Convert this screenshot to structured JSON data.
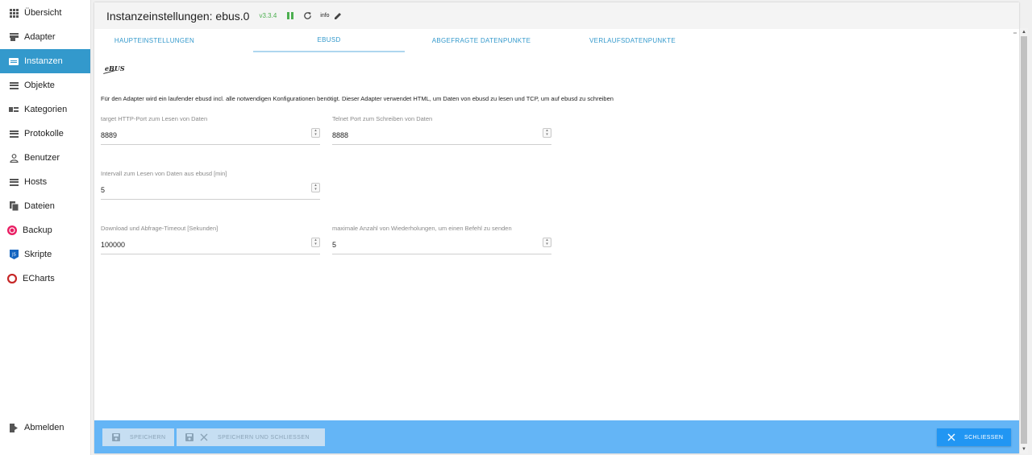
{
  "sidebar": {
    "items": [
      {
        "label": "Übersicht"
      },
      {
        "label": "Adapter"
      },
      {
        "label": "Instanzen"
      },
      {
        "label": "Objekte"
      },
      {
        "label": "Kategorien"
      },
      {
        "label": "Protokolle"
      },
      {
        "label": "Benutzer"
      },
      {
        "label": "Hosts"
      },
      {
        "label": "Dateien"
      },
      {
        "label": "Backup"
      },
      {
        "label": "Skripte"
      },
      {
        "label": "ECharts"
      }
    ],
    "logout": "Abmelden"
  },
  "header": {
    "title": "Instanzeinstellungen: ebus.0",
    "version": "v3.3.4",
    "info": "info"
  },
  "tabs": [
    "HAUPTEINSTELLUNGEN",
    "EBUSD",
    "ABGEFRAGTE DATENPUNKTE",
    "VERLAUFSDATENPUNKTE"
  ],
  "content": {
    "logo_text": "eBUS",
    "description": "Für den Adapter wird ein laufender ebusd incl. alle notwendigen Konfigurationen benötigt. Dieser Adapter verwendet HTML, um Daten von ebusd zu lesen und TCP, um auf ebusd zu schreiben",
    "fields": {
      "http_port": {
        "label": "target HTTP-Port zum Lesen von Daten",
        "value": "8889"
      },
      "telnet_port": {
        "label": "Telnet Port zum Schreiben von Daten",
        "value": "8888"
      },
      "interval": {
        "label": "Intervall zum Lesen von Daten aus ebusd [min]",
        "value": "5"
      },
      "timeout": {
        "label": "Download und Abfrage-Timeout [Sekunden]",
        "value": "100000"
      },
      "retries": {
        "label": "maximale Anzahl von Wiederholungen, um einen Befehl zu senden",
        "value": "5"
      }
    }
  },
  "footer": {
    "save": "SPEICHERN",
    "save_close": "SPEICHERN UND SCHLIESSEN",
    "close": "SCHLIESSEN"
  },
  "colors": {
    "accent": "#3399cc",
    "footer": "#64b5f6",
    "close_button": "#2196f3",
    "running": "#4caf50"
  }
}
